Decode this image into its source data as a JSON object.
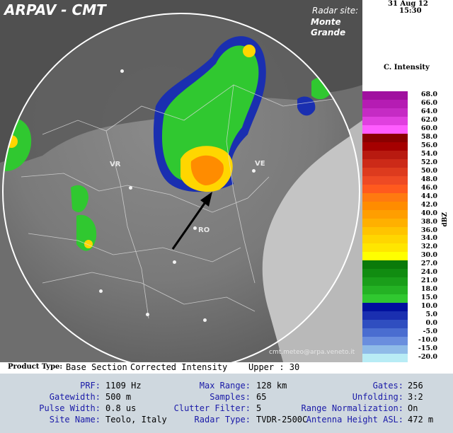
{
  "header": {
    "title": "ARPAV - CMT",
    "radar_site_label": "Radar site:",
    "radar_site_name": "Monte Grande",
    "date": "31 Aug 12",
    "time": "15:30",
    "credit": "cmt.meteo@arpa.veneto.it"
  },
  "map": {
    "cities": [
      {
        "label": "VR"
      },
      {
        "label": "VE"
      },
      {
        "label": "RO"
      }
    ]
  },
  "legend": {
    "title": "C. Intensity",
    "unit": "dBZ",
    "entries": [
      {
        "value": "68.0",
        "color": "#a0109f"
      },
      {
        "value": "66.0",
        "color": "#b51cb3"
      },
      {
        "value": "64.0",
        "color": "#c52bc4"
      },
      {
        "value": "62.0",
        "color": "#e040df"
      },
      {
        "value": "60.0",
        "color": "#ff5cff"
      },
      {
        "value": "58.0",
        "color": "#8a0000"
      },
      {
        "value": "56.0",
        "color": "#a50000"
      },
      {
        "value": "54.0",
        "color": "#b81a10"
      },
      {
        "value": "52.0",
        "color": "#cc2a18"
      },
      {
        "value": "50.0",
        "color": "#dd3b1e"
      },
      {
        "value": "48.0",
        "color": "#ee4a24"
      },
      {
        "value": "46.0",
        "color": "#ff5a1e"
      },
      {
        "value": "44.0",
        "color": "#ff7a10"
      },
      {
        "value": "42.0",
        "color": "#ff8c00"
      },
      {
        "value": "40.0",
        "color": "#ff9e00"
      },
      {
        "value": "38.0",
        "color": "#ffb000"
      },
      {
        "value": "36.0",
        "color": "#ffc400"
      },
      {
        "value": "34.0",
        "color": "#ffd600"
      },
      {
        "value": "32.0",
        "color": "#ffe600"
      },
      {
        "value": "30.0",
        "color": "#ffff00"
      },
      {
        "value": "27.0",
        "color": "#0a7a0a"
      },
      {
        "value": "24.0",
        "color": "#118c11"
      },
      {
        "value": "21.0",
        "color": "#1a9e1a"
      },
      {
        "value": "18.0",
        "color": "#24b224"
      },
      {
        "value": "15.0",
        "color": "#30c830"
      },
      {
        "value": "10.0",
        "color": "#00109e"
      },
      {
        "value": "5.0",
        "color": "#1a2fb0"
      },
      {
        "value": "0.0",
        "color": "#2f4ec0"
      },
      {
        "value": "-5.0",
        "color": "#4a6dd0"
      },
      {
        "value": "-10.0",
        "color": "#6a8ede"
      },
      {
        "value": "-15.0",
        "color": "#8fbbe8"
      },
      {
        "value": "-20.0",
        "color": "#b8ecf5"
      }
    ]
  },
  "product": {
    "type_label": "Product Type:",
    "type_value": "Base Section",
    "name": "Corrected Intensity",
    "upper_label": "Upper : 30"
  },
  "params": {
    "prf_label": "PRF:",
    "prf_value": "1109 Hz",
    "gatewidth_label": "Gatewidth:",
    "gatewidth_value": "500 m",
    "pulsewidth_label": "Pulse Width:",
    "pulsewidth_value": "0.8 us",
    "site_label": "Site Name:",
    "site_value": "Teolo, Italy",
    "maxrange_label": "Max Range:",
    "maxrange_value": "128 km",
    "samples_label": "Samples:",
    "samples_value": "65",
    "clutter_label": "Clutter Filter:",
    "clutter_value": "5",
    "radartype_label": "Radar Type:",
    "radartype_value": "TVDR-2500C",
    "gates_label": "Gates:",
    "gates_value": "256",
    "unfolding_label": "Unfolding:",
    "unfolding_value": "3:2",
    "rangenorm_label": "Range Normalization:",
    "rangenorm_value": "On",
    "antenna_label": "Antenna Height ASL:",
    "antenna_value": "472 m"
  }
}
